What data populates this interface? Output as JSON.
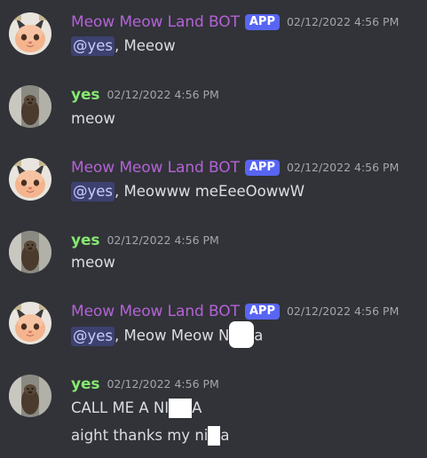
{
  "colors": {
    "background": "#313338",
    "bot_name": "#b462d6",
    "yes_name": "#86e86f",
    "app_tag": "#5865f2",
    "timestamp": "#a3a6aa",
    "text": "#dbdee1",
    "mention_bg": "rgba(88,101,242,0.3)"
  },
  "messages": [
    {
      "author": "Meow Meow Land BOT",
      "tag": "APP",
      "timestamp": "02/12/2022 4:56 PM",
      "mention": "@yes",
      "text": ", Meeow"
    },
    {
      "author": "yes",
      "timestamp": "02/12/2022 4:56 PM",
      "text": "meow"
    },
    {
      "author": "Meow Meow Land BOT",
      "tag": "APP",
      "timestamp": "02/12/2022 4:56 PM",
      "mention": "@yes",
      "text": ", Meowww meEeeOowwW"
    },
    {
      "author": "yes",
      "timestamp": "02/12/2022 4:56 PM",
      "text": "meow"
    },
    {
      "author": "Meow Meow Land BOT",
      "tag": "APP",
      "timestamp": "02/12/2022 4:56 PM",
      "mention": "@yes",
      "text_before": ", Meow Meow N",
      "text_after": "a"
    },
    {
      "author": "yes",
      "timestamp": "02/12/2022 4:56 PM",
      "line1_before": "CALL ME A NI",
      "line1_after": "A",
      "line2_before": "aight thanks my ni",
      "line2_after": "a"
    }
  ]
}
